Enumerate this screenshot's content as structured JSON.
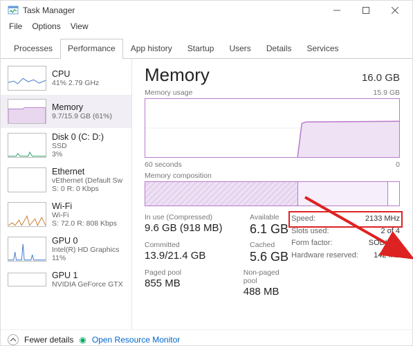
{
  "window": {
    "title": "Task Manager"
  },
  "menu": {
    "file": "File",
    "options": "Options",
    "view": "View"
  },
  "tabs": {
    "items": [
      {
        "label": "Processes"
      },
      {
        "label": "Performance"
      },
      {
        "label": "App history"
      },
      {
        "label": "Startup"
      },
      {
        "label": "Users"
      },
      {
        "label": "Details"
      },
      {
        "label": "Services"
      }
    ],
    "active": 1
  },
  "sidebar": {
    "items": [
      {
        "name": "CPU",
        "sub1": "41%  2.79 GHz",
        "color": "#3a78c9"
      },
      {
        "name": "Memory",
        "sub1": "9.7/15.9 GB (61%)",
        "color": "#b97acb",
        "selected": true
      },
      {
        "name": "Disk 0 (C: D:)",
        "sub1": "SSD",
        "sub2": "3%",
        "color": "#2aa36a"
      },
      {
        "name": "Ethernet",
        "sub1": "vEthernet (Default Sw",
        "sub2": "S: 0  R: 0 Kbps",
        "color": "#c97a2a"
      },
      {
        "name": "Wi-Fi",
        "sub1": "Wi-Fi",
        "sub2": "S: 72.0  R: 808 Kbps",
        "color": "#c97a2a"
      },
      {
        "name": "GPU 0",
        "sub1": "Intel(R) HD Graphics",
        "sub2": "11%",
        "color": "#3a78c9"
      },
      {
        "name": "GPU 1",
        "sub1": "NVIDIA GeForce GTX",
        "color": "#3a78c9"
      }
    ]
  },
  "memory": {
    "title": "Memory",
    "total": "16.0 GB",
    "usage_label": "Memory usage",
    "usage_max": "15.9 GB",
    "x_left": "60 seconds",
    "x_right": "0",
    "comp_label": "Memory composition",
    "stats": {
      "inuse_label": "In use (Compressed)",
      "inuse_val": "9.6 GB (918 MB)",
      "avail_label": "Available",
      "avail_val": "6.1 GB",
      "committed_label": "Committed",
      "committed_val": "13.9/21.4 GB",
      "cached_label": "Cached",
      "cached_val": "5.6 GB",
      "paged_label": "Paged pool",
      "paged_val": "855 MB",
      "nonpaged_label": "Non-paged pool",
      "nonpaged_val": "488 MB"
    },
    "kv": {
      "speed_k": "Speed:",
      "speed_v": "2133 MHz",
      "slots_k": "Slots used:",
      "slots_v": "2 of 4",
      "form_k": "Form factor:",
      "form_v": "SODIMM",
      "hw_k": "Hardware reserved:",
      "hw_v": "142 MB"
    }
  },
  "footer": {
    "fewer": "Fewer details",
    "orm": "Open Resource Monitor"
  },
  "chart_data": {
    "type": "area",
    "title": "Memory usage",
    "ylabel": "GB",
    "ylim": [
      0,
      15.9
    ],
    "x": [
      60,
      50,
      40,
      30,
      24,
      20,
      10,
      0
    ],
    "values": [
      0,
      0,
      0,
      0,
      9.7,
      9.7,
      9.6,
      9.7
    ],
    "composition": {
      "in_use_gb": 9.6,
      "cached_gb": 5.6,
      "free_gb": 0.7,
      "total_gb": 15.9
    }
  }
}
